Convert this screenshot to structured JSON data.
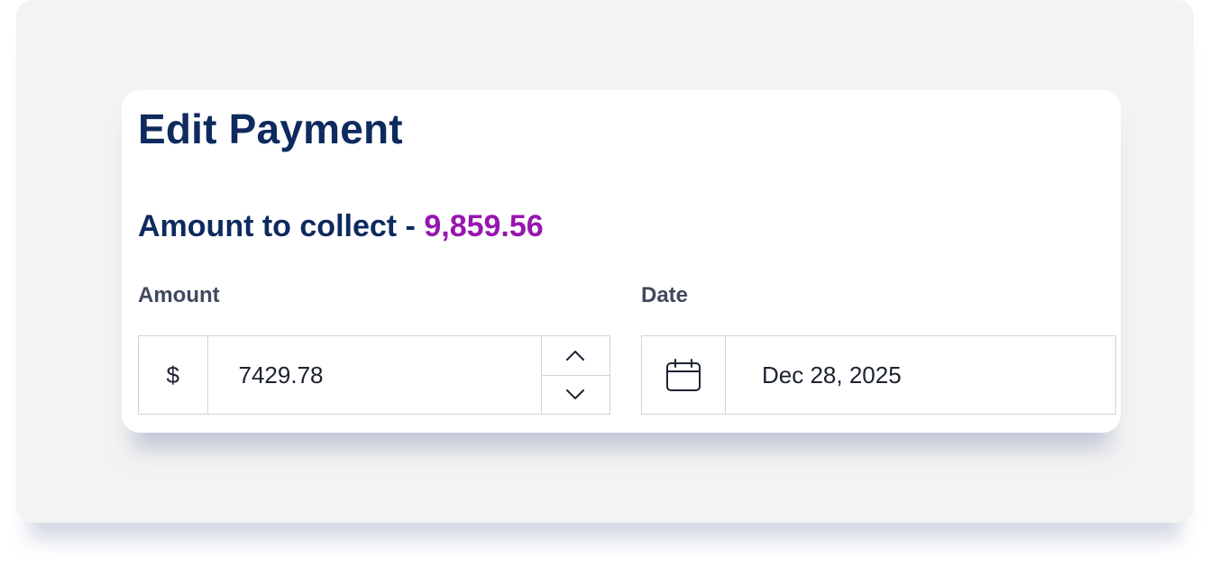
{
  "dialog": {
    "title": "Edit Payment",
    "collect_label": "Amount to collect -",
    "collect_amount": "9,859.56"
  },
  "amount_field": {
    "label": "Amount",
    "currency_symbol": "$",
    "value": "7429.78"
  },
  "date_field": {
    "label": "Date",
    "value": "Dec 28, 2025"
  },
  "icons": {
    "stepper_up": "chevron-up-icon",
    "stepper_down": "chevron-down-icon",
    "calendar": "calendar-icon"
  },
  "colors": {
    "title": "#0e2a5e",
    "collect_amount": "#9616b0",
    "field_label": "#3f4a5c",
    "border": "#cfd3dc",
    "background_panel": "#f3f3f3"
  }
}
